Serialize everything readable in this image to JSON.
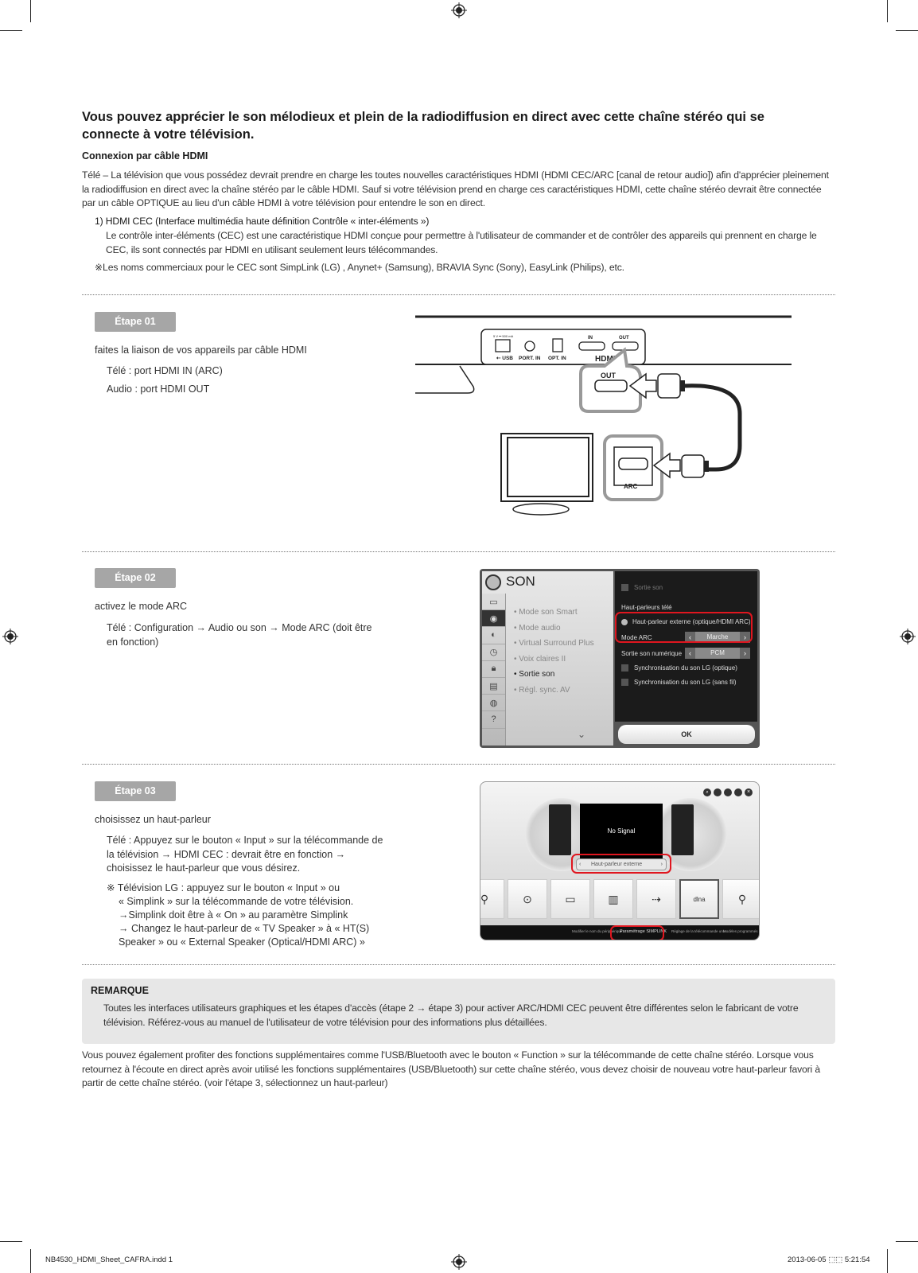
{
  "header": {
    "title": "Vous pouvez apprécier le son mélodieux et plein de la radiodiffusion en direct avec cette chaîne stéréo qui se connecte à votre télévision.",
    "subtitle": "Connexion par câble HDMI",
    "intro": "Télé – La télévision que vous possédez devrait prendre en charge les toutes nouvelles caractéristiques HDMI (HDMI CEC/ARC [canal de retour audio]) afin d'apprécier pleinement la radiodiffusion en direct avec la chaîne stéréo par le câble HDMI. Sauf si votre télévision prend en charge ces caractéristiques HDMI, cette chaîne stéréo devrait être connectée par un câble OPTIQUE au lieu d'un câble HDMI à votre télévision pour entendre le son en direct.",
    "cec_heading": "1) HDMI CEC (Interface multimédia haute définition Contrôle « inter-éléments »)",
    "cec_body": "Le contrôle inter-éléments (CEC) est une caractéristique HDMI conçue pour permettre à l'utilisateur de commander et de contrôler des appareils qui prennent en charge le CEC, ils sont connectés par HDMI en utilisant seulement leurs télécommandes.",
    "cec_note": "※Les noms commerciaux pour le CEC sont SimpLink (LG) , Anynet+ (Samsung), BRAVIA Sync (Sony), EasyLink (Philips), etc."
  },
  "steps": [
    {
      "badge": "Étape 01",
      "title": "faites la liaison de vos appareils par câble HDMI",
      "lines": [
        "Télé : port HDMI IN (ARC)",
        "Audio : port  HDMI OUT"
      ],
      "diagram": {
        "port_labels": [
          "5 V ⎓ 500 mA",
          "USB",
          "PORT. IN",
          "OPT. IN",
          "IN",
          "OUT",
          "HDMI"
        ],
        "callout_out": "OUT",
        "callout_arc": "ARC"
      }
    },
    {
      "badge": "Étape 02",
      "title": "activez le mode ARC",
      "lines": [
        "Télé : Configuration → Audio ou son → Mode ARC (doit être en fonction)"
      ],
      "tv_menu": {
        "title": "SON",
        "menu_items": [
          "Mode son Smart",
          "Mode audio",
          "Virtual Surround Plus",
          "Voix claires II",
          "Sortie son",
          "Régl. sync. AV"
        ],
        "selected_item": "Sortie son",
        "panel": {
          "sortie_son": "Sortie son",
          "section": "Haut-parleurs télé",
          "option_external": "Haut-parleur externe (optique/HDMI ARC)",
          "mode_arc_label": "Mode ARC",
          "mode_arc_value": "Marche",
          "digital_label": "Sortie son numérique",
          "digital_value": "PCM",
          "sync_optical": "Synchronisation du son LG (optique)",
          "sync_wireless": "Synchronisation du son LG (sans fil)",
          "ok": "OK"
        }
      }
    },
    {
      "badge": "Étape 03",
      "title": "choisissez un haut-parleur",
      "lines": [
        "Télé : Appuyez sur le bouton « Input » sur la télécommande de la télévision → HDMI CEC : devrait être en fonction → choisissez le haut-parleur que vous désirez."
      ],
      "note": [
        "※ Télévision LG : appuyez sur le bouton « Input » ou",
        "« Simplink » sur la télécommande de votre télévision.",
        "→Simplink doit être à « On » au paramètre Simplink",
        "→ Changez le haut-parleur de « TV Speaker » à « HT(S)",
        "Speaker » ou « External Speaker (Optical/HDMI ARC) »"
      ],
      "tv_input": {
        "no_signal": "No Signal",
        "speaker_value": "Haut-parleur externe",
        "toolbar": [
          "Modifier le nom du périphérique",
          "Paramétrage SIMPLINK",
          "Réglage de la télécommande univ.",
          "Modèles programmés"
        ]
      }
    }
  ],
  "remarque": {
    "title": "REMARQUE",
    "body": "Toutes les interfaces utilisateurs graphiques et les étapes d'accès (étape 2 → étape 3) pour activer ARC/HDMI CEC peuvent être différentes selon le fabricant de votre télévision. Référez-vous au manuel de l'utilisateur de votre télévision pour des informations plus détaillées."
  },
  "closing": "Vous pouvez également profiter des fonctions supplémentaires comme l'USB/Bluetooth avec le bouton « Function » sur la télécommande de cette chaîne stéréo. Lorsque vous retournez à l'écoute en direct après avoir utilisé les fonctions supplémentaires (USB/Bluetooth) sur cette chaîne stéréo, vous devez choisir de nouveau votre haut-parleur favori à partir de cette chaîne stéréo. (voir l'étape 3, sélectionnez un haut-parleur)",
  "footer": {
    "file": "NB4530_HDMI_Sheet_CAFRA.indd   1",
    "datetime": "2013-06-05   ⬚⬚ 5:21:54"
  }
}
